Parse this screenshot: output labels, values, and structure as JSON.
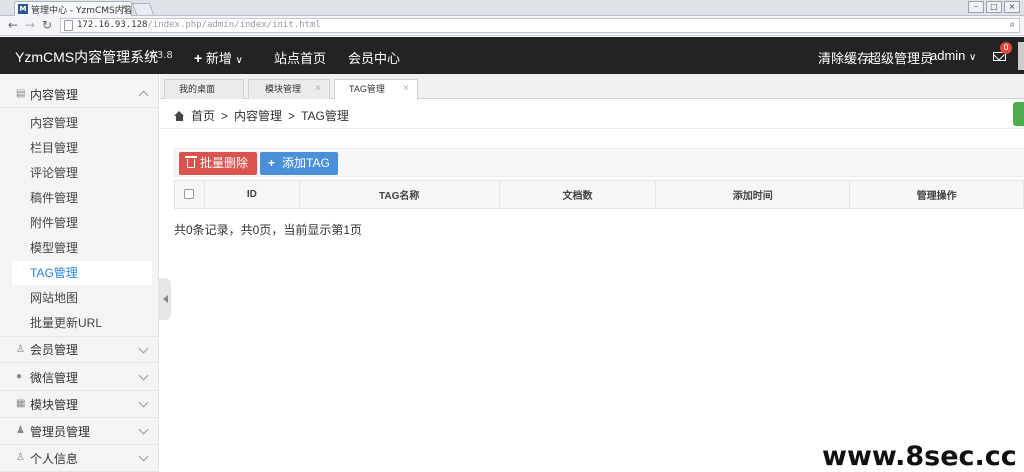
{
  "browser": {
    "tab_title": "管理中心 - YzmCMS内容管",
    "favicon_letter": "M",
    "url_host": "172.16.93.128",
    "url_path": "/index.php/admin/index/init.html"
  },
  "header": {
    "logo": "YzmCMS内容管理系统",
    "version": "V3.8",
    "new_label": "新增",
    "site_home": "站点首页",
    "member_center": "会员中心",
    "clear_cache": "清除缓存",
    "role": "超级管理员",
    "user": "admin",
    "message_count": "0"
  },
  "sidebar": {
    "groups": [
      {
        "label": "内容管理",
        "icon": "list-icon"
      },
      {
        "label": "会员管理",
        "icon": "user-icon"
      },
      {
        "label": "微信管理",
        "icon": "wechat-icon"
      },
      {
        "label": "模块管理",
        "icon": "grid-icon"
      },
      {
        "label": "管理员管理",
        "icon": "admin-icon"
      },
      {
        "label": "个人信息",
        "icon": "person-icon"
      }
    ],
    "items": [
      {
        "label": "内容管理"
      },
      {
        "label": "栏目管理"
      },
      {
        "label": "评论管理"
      },
      {
        "label": "稿件管理"
      },
      {
        "label": "附件管理"
      },
      {
        "label": "模型管理"
      },
      {
        "label": "TAG管理"
      },
      {
        "label": "网站地图"
      },
      {
        "label": "批量更新URL"
      }
    ],
    "active_item": "TAG管理"
  },
  "tabs": [
    {
      "label": "我的桌面"
    },
    {
      "label": "模块管理"
    },
    {
      "label": "TAG管理"
    }
  ],
  "breadcrumb": {
    "home": "首页",
    "sep": ">",
    "level1": "内容管理",
    "level2": "TAG管理"
  },
  "toolbar": {
    "batch_delete": "批量删除",
    "add_tag": "添加TAG"
  },
  "table": {
    "columns": [
      "ID",
      "TAG名称",
      "文档数",
      "添加时间",
      "管理操作"
    ]
  },
  "records_text": "共0条记录，共0页，当前显示第1页",
  "watermark": "www.8sec.cc"
}
